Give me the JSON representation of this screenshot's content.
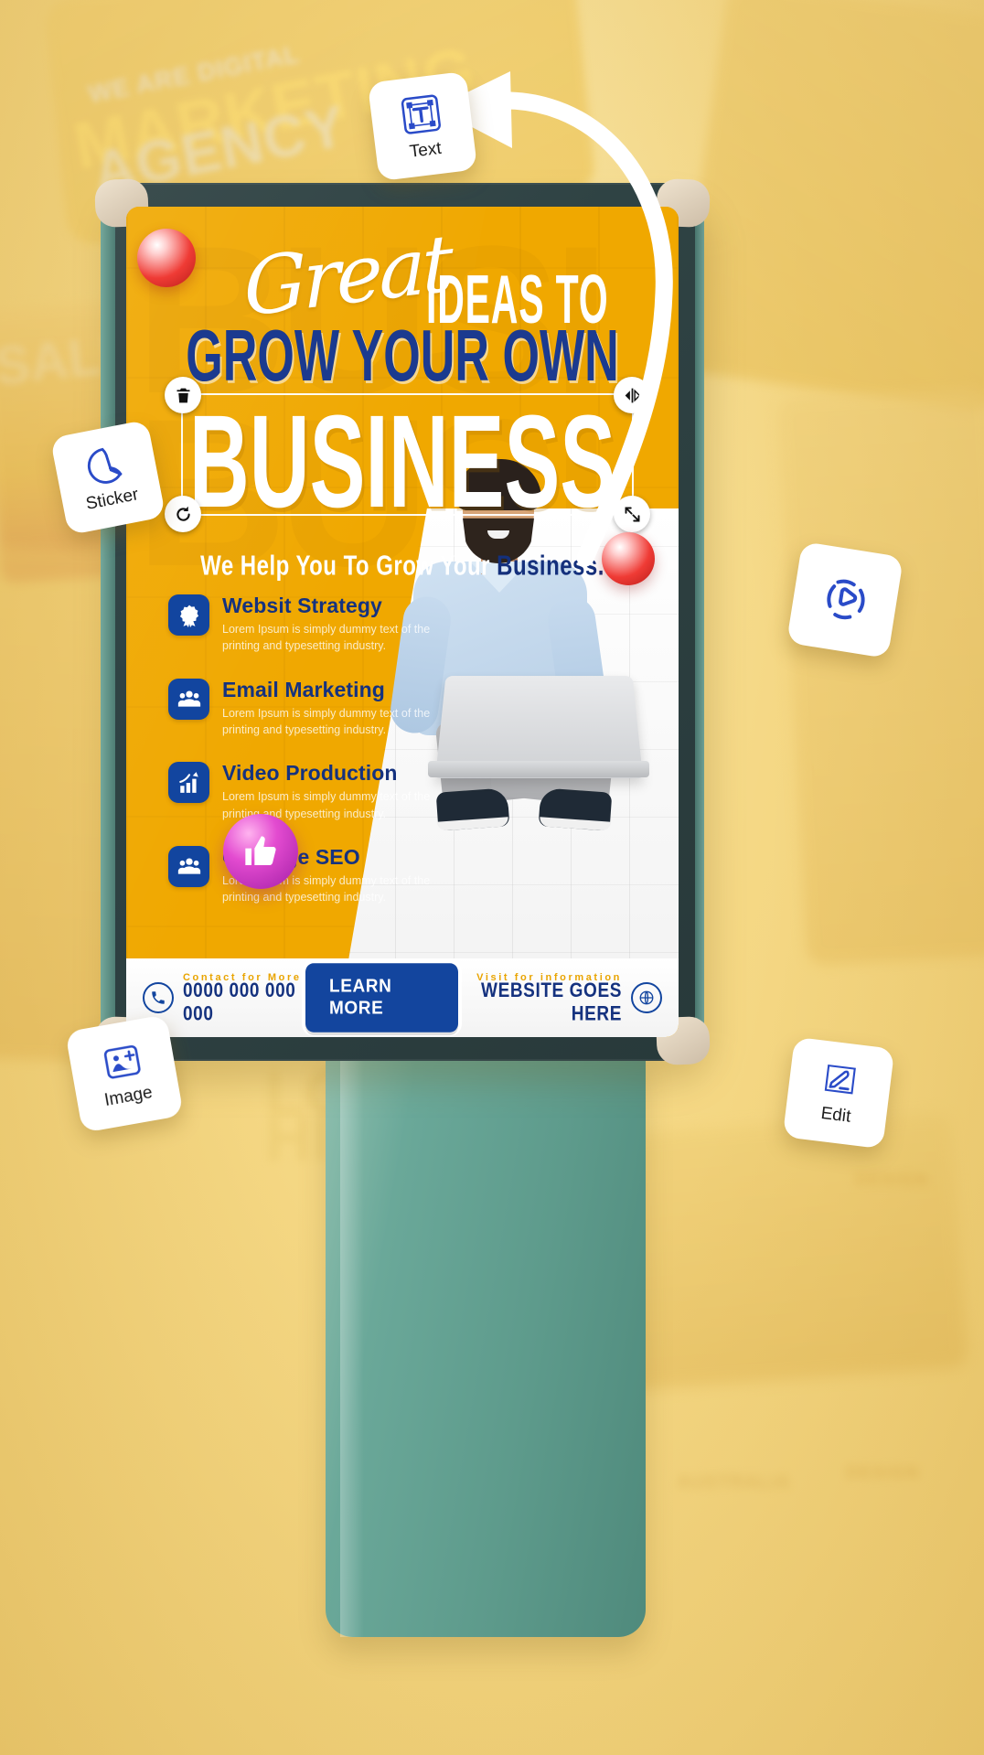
{
  "background": {
    "watermark_lines": [
      "WE ARE DIGITAL",
      "MARKETING",
      "AGENCY"
    ],
    "ghost_words": [
      "LO",
      "HI",
      "SALE",
      "AUSTRALIA",
      "DESIGN"
    ],
    "base_color": "#f5d885"
  },
  "billboard": {
    "frame_color": "#2f4344",
    "accent_teal": "#6aa899",
    "screen_bg": "#f0a800"
  },
  "poster": {
    "headline": {
      "script_word": "Great",
      "line1_rest": "IDEAS TO",
      "line2": "GROW YOUR OWN",
      "line3": "BUSINESS",
      "subtitle_plain": "We Help  You To Grow Your ",
      "subtitle_accent": "Business.",
      "ghost_letters": "BUSI\nBUSI",
      "colors": {
        "white": "#ffffff",
        "blue": "#1b3a8f",
        "yellow": "#f0a800"
      }
    },
    "features": [
      {
        "icon": "badge-ribbon-icon",
        "title": "Websit Strategy",
        "desc": "Lorem Ipsum is simply dummy text of the printing and typesetting industry."
      },
      {
        "icon": "people-group-icon",
        "title": "Email Marketing",
        "desc": "Lorem Ipsum is simply dummy text of the printing and typesetting industry."
      },
      {
        "icon": "growth-chart-icon",
        "title": "Video Production",
        "desc": "Lorem Ipsum is simply dummy text of the printing and typesetting industry."
      },
      {
        "icon": "people-group-icon",
        "title": "Off Page SEO",
        "desc": "Lorem Ipsum is simply dummy text of the printing and typesetting industry."
      }
    ],
    "footer": {
      "contact_label": "Contact for More",
      "contact_value": "0000 000 000 000",
      "cta_label": "LEARN MORE",
      "visit_label": "Visit for information",
      "visit_value": "WEBSITE GOES HERE",
      "phone_icon": "phone-ring-icon",
      "globe_icon": "globe-icon"
    }
  },
  "selection": {
    "target": "BUSINESS",
    "handles": [
      {
        "name": "delete-handle",
        "icon": "trash-icon",
        "position": "top-left"
      },
      {
        "name": "flip-handle",
        "icon": "flip-horizontal-icon",
        "position": "top-right"
      },
      {
        "name": "rotate-handle",
        "icon": "rotate-icon",
        "position": "bottom-left"
      },
      {
        "name": "resize-handle",
        "icon": "expand-arrows-icon",
        "position": "bottom-right"
      }
    ]
  },
  "tools": [
    {
      "id": "text",
      "label": "Text",
      "icon": "text-box-icon"
    },
    {
      "id": "sticker",
      "label": "Sticker",
      "icon": "sticker-circle-icon"
    },
    {
      "id": "video",
      "label": "",
      "icon": "play-circle-icon"
    },
    {
      "id": "image",
      "label": "Image",
      "icon": "image-plus-icon"
    },
    {
      "id": "edit",
      "label": "Edit",
      "icon": "pencil-edit-icon"
    }
  ],
  "decorations": {
    "bubbles": [
      "red-sphere",
      "red-sphere",
      "thumbs-up-bubble"
    ],
    "arrow": "curved-white-arrow"
  }
}
